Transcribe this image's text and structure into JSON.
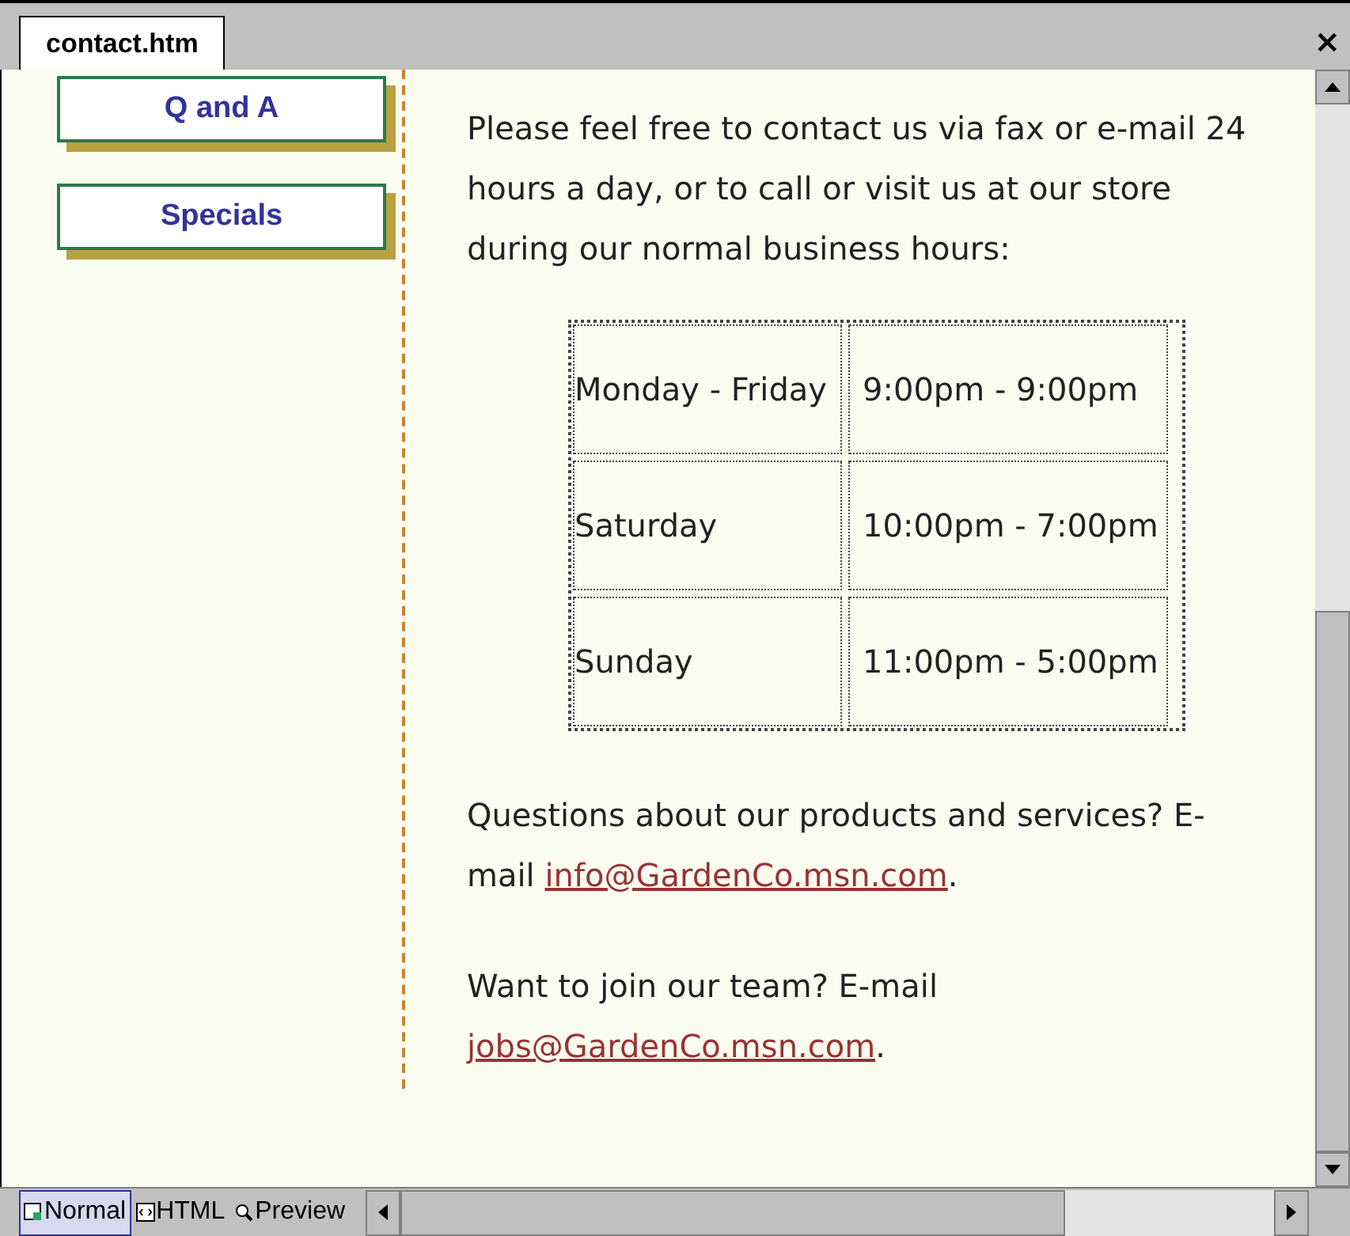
{
  "document_tab": {
    "title": "contact.htm",
    "close": "×"
  },
  "nav_buttons": [
    {
      "label": "Q and A"
    },
    {
      "label": "Specials"
    }
  ],
  "intro": "Please feel free to contact us via fax or e-mail 24 hours a day, or to call or visit us at our store during our normal business hours:",
  "hours": [
    {
      "days": "Monday - Friday",
      "time": "9:00pm - 9:00pm"
    },
    {
      "days": "Saturday",
      "time": "10:00pm - 7:00pm"
    },
    {
      "days": "Sunday",
      "time": "11:00pm - 5:00pm"
    }
  ],
  "contact_lines": [
    {
      "text_before": "Questions about our products and services? E-mail ",
      "link": "info@GardenCo.msn.com",
      "text_after": "."
    },
    {
      "text_before": "Want to join our team? E-mail ",
      "link": "jobs@GardenCo.msn.com",
      "text_after": "."
    }
  ],
  "view_tabs": [
    {
      "kind": "normal",
      "label": "Normal",
      "selected": true
    },
    {
      "kind": "html",
      "label": "HTML",
      "selected": false
    },
    {
      "kind": "preview",
      "label": "Preview",
      "selected": false
    }
  ]
}
